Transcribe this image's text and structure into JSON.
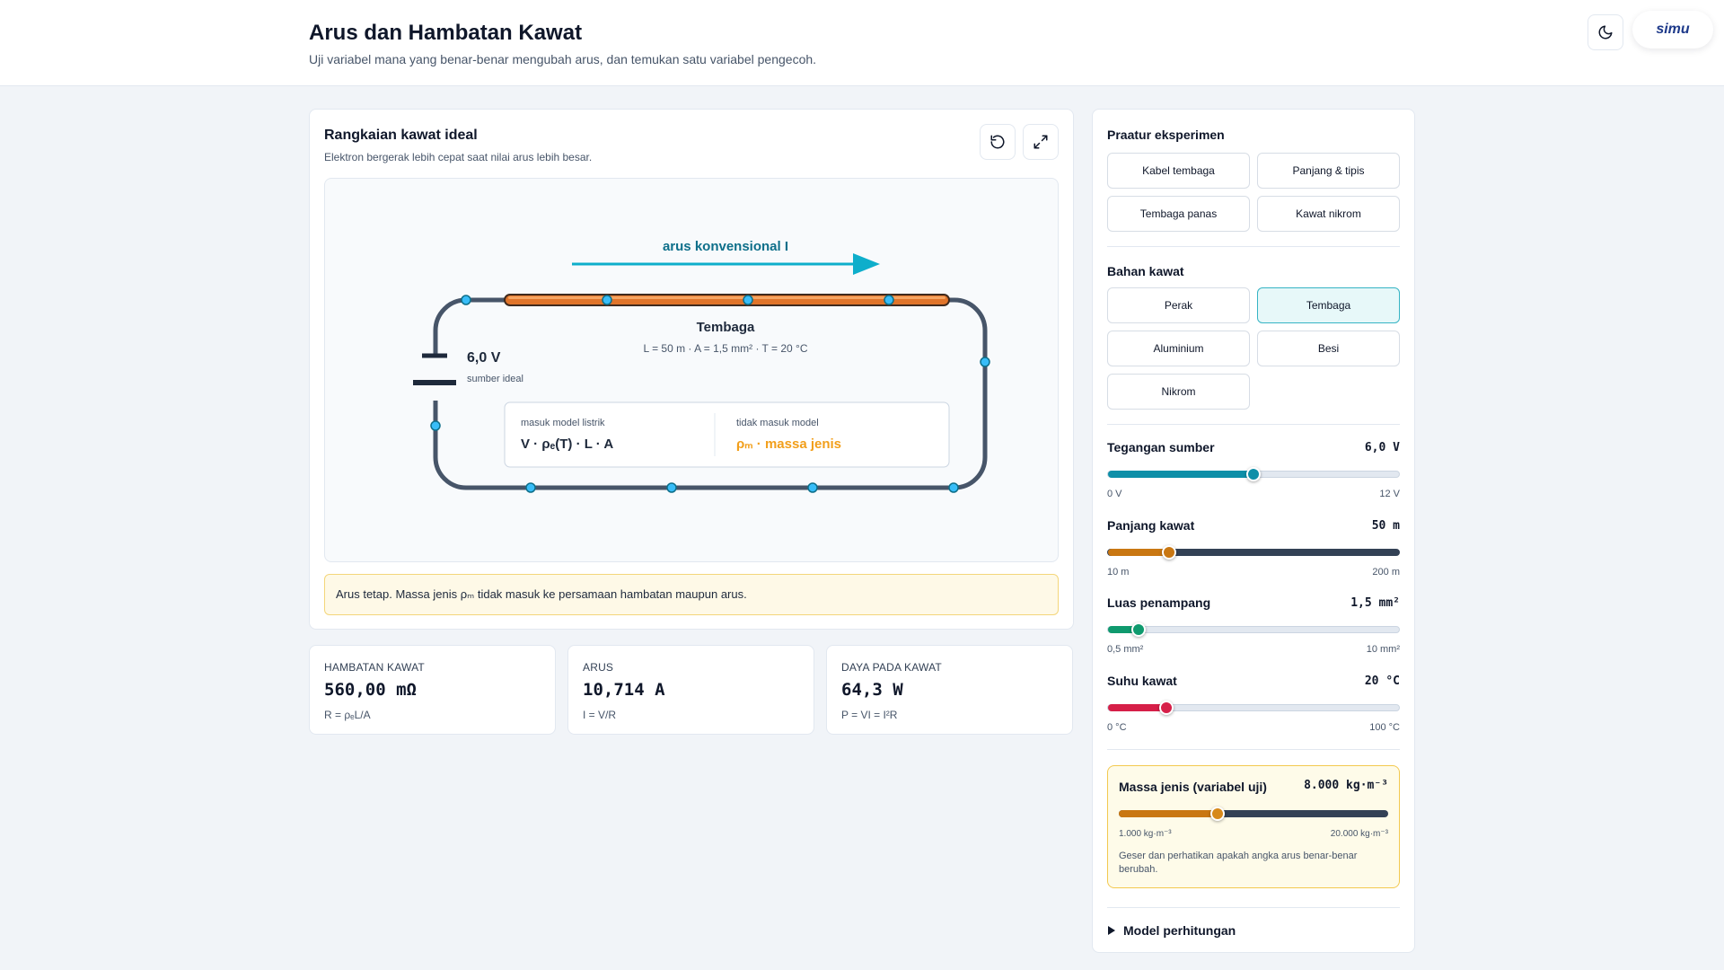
{
  "header": {
    "title": "Arus dan Hambatan Kawat",
    "subtitle": "Uji variabel mana yang benar-benar mengubah arus, dan temukan satu variabel pengecoh.",
    "logo_text": "simu"
  },
  "simulation": {
    "title": "Rangkaian kawat ideal",
    "subtitle": "Elektron bergerak lebih cepat saat nilai arus lebih besar.",
    "arrow_label": "arus konvensional I",
    "wire_material": "Tembaga",
    "wire_params": "L = 50 m · A = 1,5 mm² · T = 20 °C",
    "source_voltage": "6,0 V",
    "source_label": "sumber ideal",
    "in_model_label": "masuk model listrik",
    "in_model_value": "V · ρₑ(T) · L · A",
    "out_model_label": "tidak masuk model",
    "out_model_value": "ρₘ · massa jenis",
    "note": "Arus tetap. Massa jenis ρₘ tidak masuk ke persamaan hambatan maupun arus.",
    "colors": {
      "wire_copper": "#e0742a",
      "arrow": "#0eaecb",
      "circuit": "#475569",
      "highlight": "#f29f1b"
    }
  },
  "metrics": [
    {
      "label": "HAMBATAN KAWAT",
      "value": "560,00 mΩ",
      "formula": "R = ρₑL/A"
    },
    {
      "label": "ARUS",
      "value": "10,714 A",
      "formula": "I = V/R"
    },
    {
      "label": "DAYA PADA KAWAT",
      "value": "64,3 W",
      "formula": "P = VI = I²R"
    }
  ],
  "presets": {
    "title": "Praatur eksperimen",
    "items": [
      "Kabel tembaga",
      "Panjang & tipis",
      "Tembaga panas",
      "Kawat nikrom"
    ]
  },
  "materials": {
    "title": "Bahan kawat",
    "items": [
      "Perak",
      "Tembaga",
      "Aluminium",
      "Besi",
      "Nikrom"
    ],
    "selected": "Tembaga"
  },
  "sliders": {
    "voltage": {
      "label": "Tegangan sumber",
      "value": "6,0 V",
      "min": "0 V",
      "max": "12 V",
      "fraction": 0.5,
      "color": "#0e8fa8"
    },
    "length": {
      "label": "Panjang kawat",
      "value": "50 m",
      "min": "10 m",
      "max": "200 m",
      "fraction": 0.21,
      "color": "#c97712"
    },
    "area": {
      "label": "Luas penampang",
      "value": "1,5 mm²",
      "min": "0,5 mm²",
      "max": "10 mm²",
      "fraction": 0.105,
      "color": "#0f9a6e"
    },
    "temperature": {
      "label": "Suhu kawat",
      "value": "20 °C",
      "min": "0 °C",
      "max": "100 °C",
      "fraction": 0.2,
      "color": "#d61f48"
    }
  },
  "test_variable": {
    "label": "Massa jenis (variabel uji)",
    "value": "8.000 kg·m⁻³",
    "min": "1.000 kg·m⁻³",
    "max": "20.000 kg·m⁻³",
    "fraction": 0.368,
    "hint": "Geser dan perhatikan apakah angka arus benar-benar berubah."
  },
  "model_toggle": "Model perhitungan"
}
